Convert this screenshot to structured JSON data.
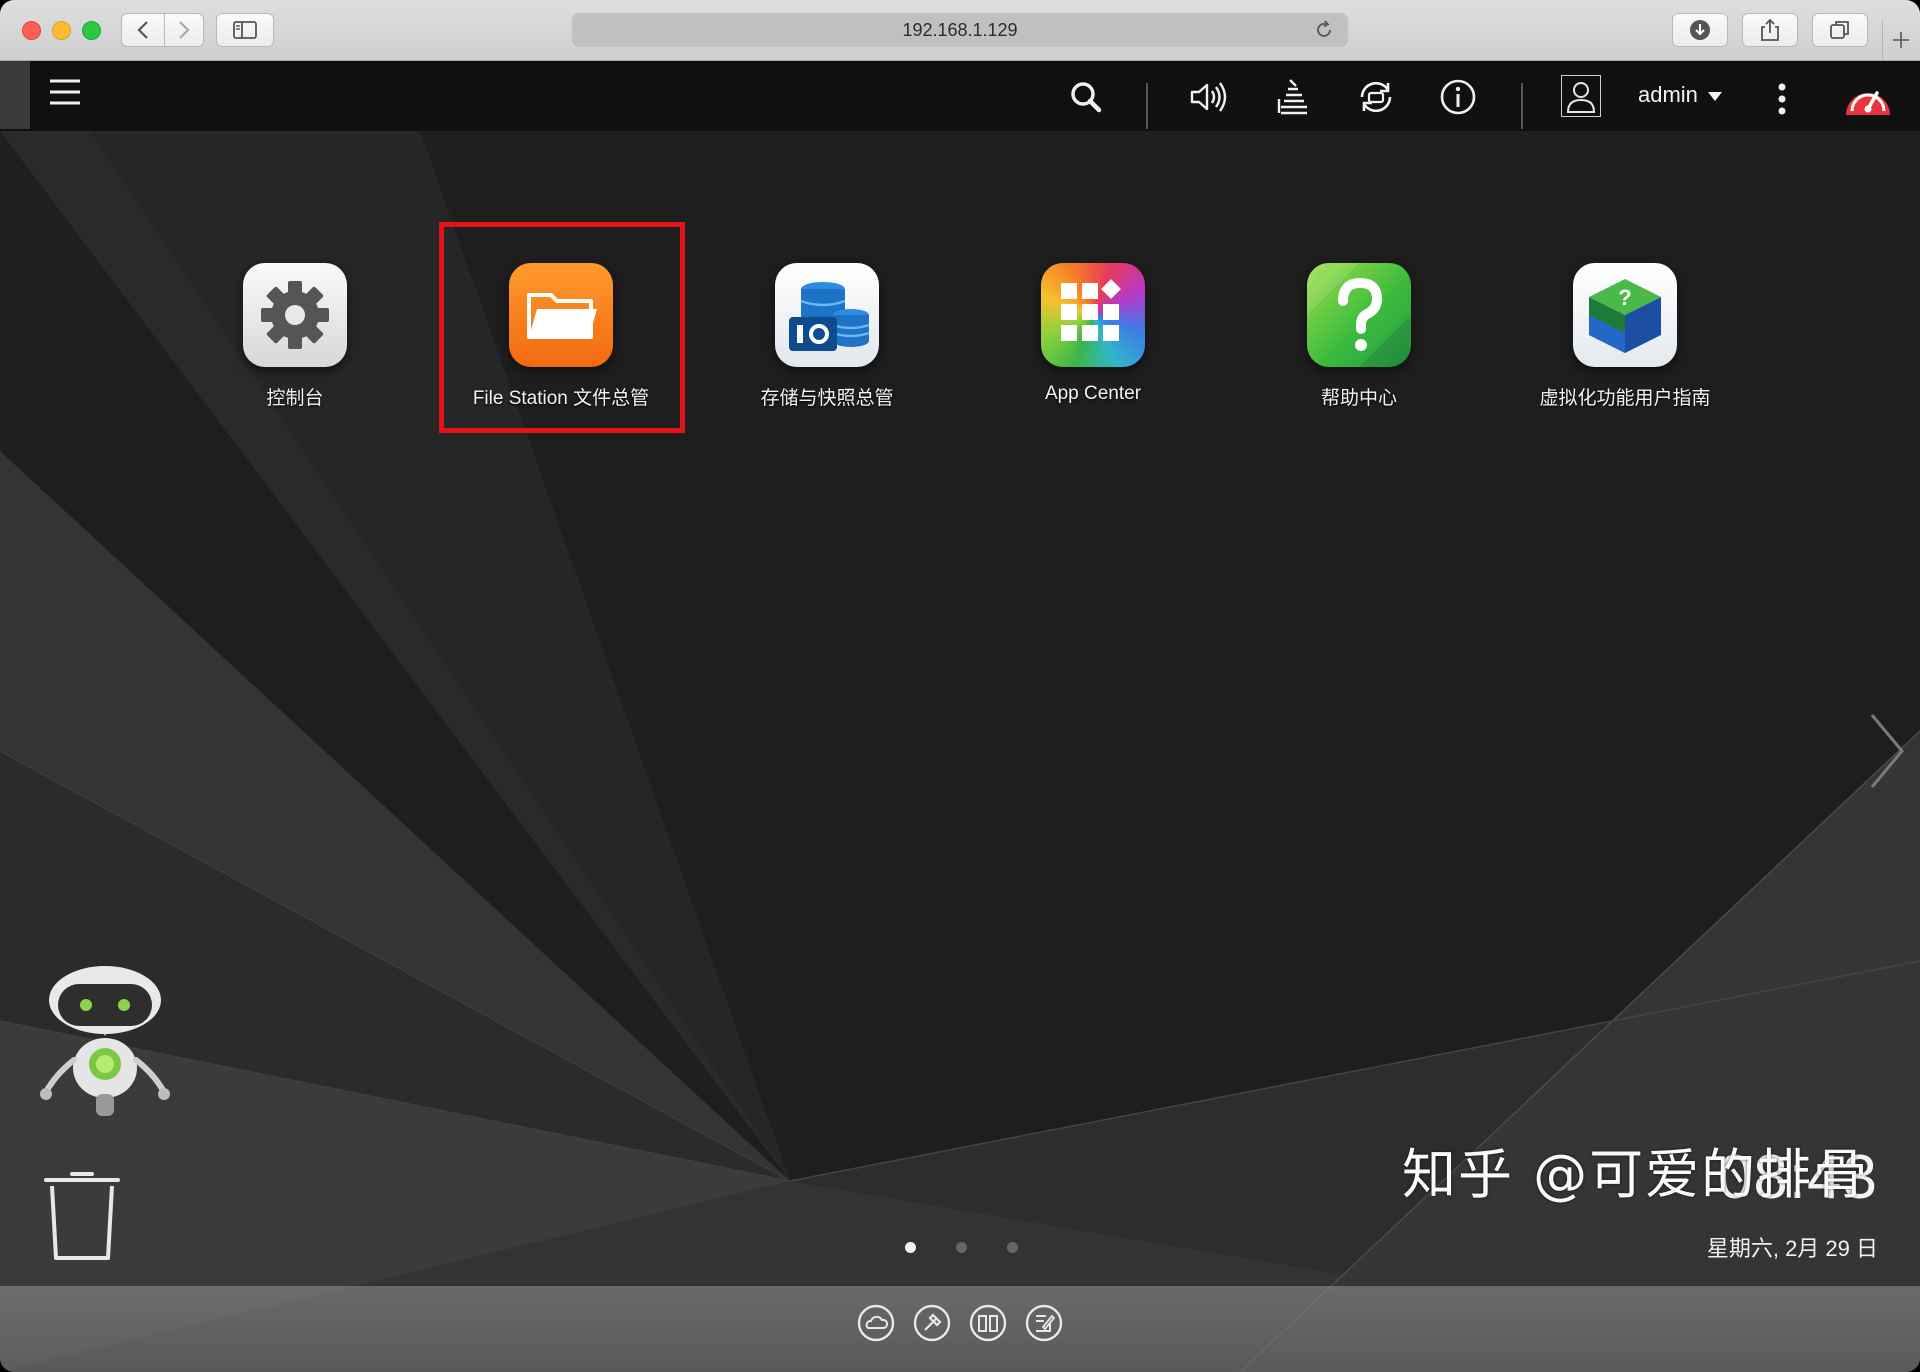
{
  "browser": {
    "url": "192.168.1.129"
  },
  "topbar": {
    "username": "admin",
    "icons": [
      "menu-icon",
      "search-icon",
      "volume-icon",
      "event-log-icon",
      "sync-icon",
      "info-icon",
      "user-icon",
      "more-icon",
      "resource-monitor-icon"
    ]
  },
  "apps": [
    {
      "label": "控制台",
      "icon": "gear-icon"
    },
    {
      "label": "File Station 文件总管",
      "icon": "folder-icon"
    },
    {
      "label": "存储与快照总管",
      "icon": "storage-icon"
    },
    {
      "label": "App Center",
      "icon": "app-grid-icon"
    },
    {
      "label": "帮助中心",
      "icon": "help-icon"
    },
    {
      "label": "虚拟化功能用户指南",
      "icon": "cube-icon"
    }
  ],
  "clock": {
    "time": "08:43",
    "date": "星期六, 2月 29 日"
  },
  "pager": {
    "pages": 3,
    "active": 1
  },
  "watermark": "知乎 @可爱的排骨",
  "colors": {
    "highlight": "#e4131a",
    "file_station": "#ff7a1a",
    "qts_red": "#e8343a"
  }
}
